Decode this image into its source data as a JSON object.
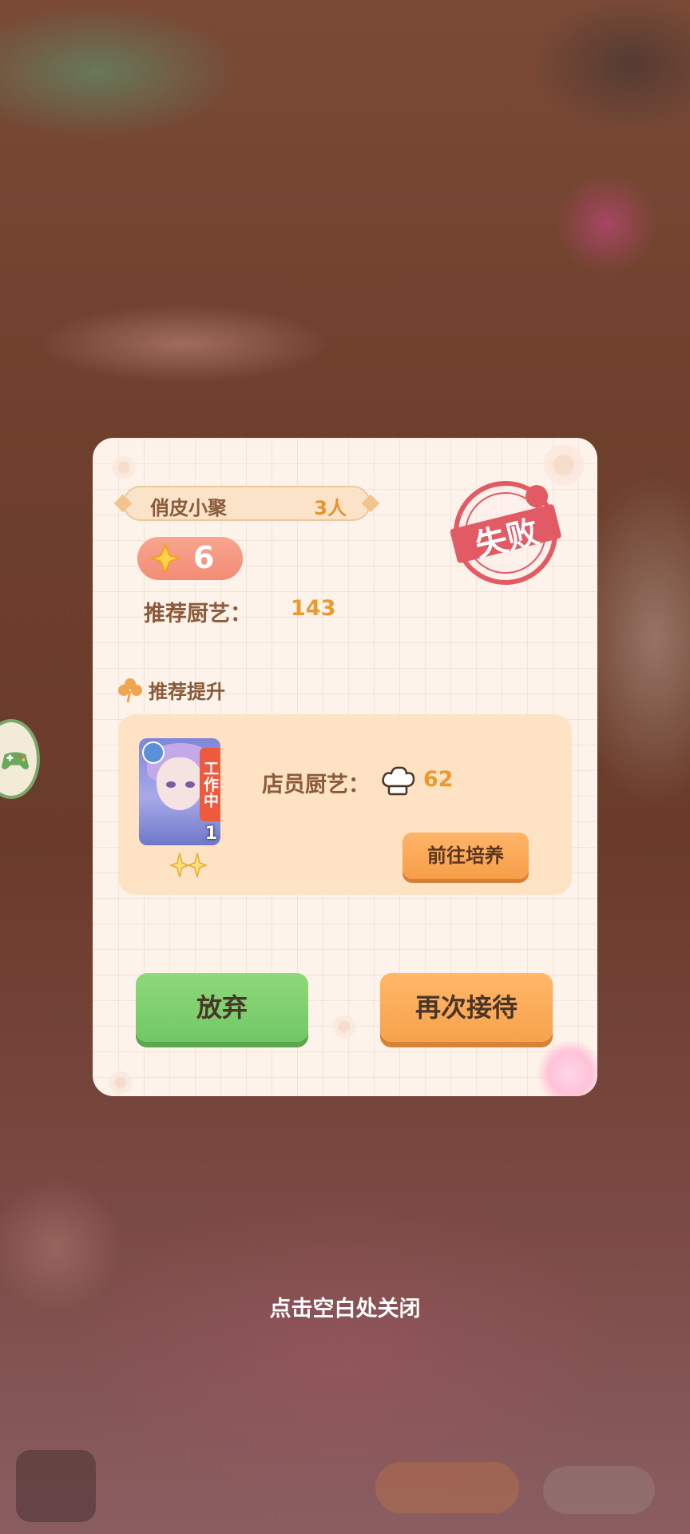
{
  "popup": {
    "topic": {
      "name": "俏皮小聚",
      "count": "3人"
    },
    "level": "6",
    "recommended": {
      "label": "推荐厨艺：",
      "value": "143"
    },
    "result_stamp": "失败",
    "section_title": "推荐提升",
    "staff": {
      "status_tag": "工作中",
      "level": "1",
      "star_count": 2,
      "cooking_label": "店员厨艺：",
      "cooking_value": "62",
      "train_button": "前往培养"
    },
    "buttons": {
      "abandon": "放弃",
      "retry": "再次接待"
    }
  },
  "close_hint": "点击空白处关闭",
  "colors": {
    "accent_orange": "#eb9a2e",
    "fail_red": "#e25a63",
    "green_button": "#7fd06f",
    "orange_button": "#f9a651"
  },
  "icons": [
    "diamond-icon",
    "clover-icon",
    "chef-hat-icon",
    "star-icon",
    "gamepad-icon"
  ]
}
